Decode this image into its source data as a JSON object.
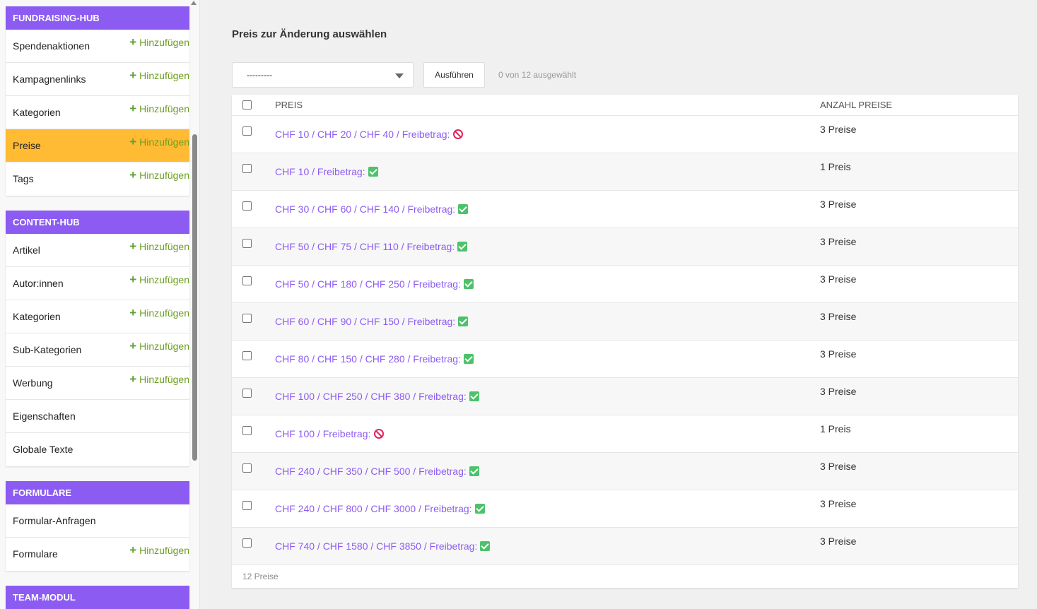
{
  "sidebar": {
    "modules": [
      {
        "title": "FUNDRAISING-HUB",
        "items": [
          {
            "label": "Spendenaktionen",
            "add": "Hinzufügen"
          },
          {
            "label": "Kampagnenlinks",
            "add": "Hinzufügen"
          },
          {
            "label": "Kategorien",
            "add": "Hinzufügen"
          },
          {
            "label": "Preise",
            "add": "Hinzufügen",
            "active": true
          },
          {
            "label": "Tags",
            "add": "Hinzufügen"
          }
        ]
      },
      {
        "title": "CONTENT-HUB",
        "items": [
          {
            "label": "Artikel",
            "add": "Hinzufügen"
          },
          {
            "label": "Autor:innen",
            "add": "Hinzufügen"
          },
          {
            "label": "Kategorien",
            "add": "Hinzufügen"
          },
          {
            "label": "Sub-Kategorien",
            "add": "Hinzufügen"
          },
          {
            "label": "Werbung",
            "add": "Hinzufügen"
          },
          {
            "label": "Eigenschaften",
            "add": ""
          },
          {
            "label": "Globale Texte",
            "add": ""
          }
        ]
      },
      {
        "title": "FORMULARE",
        "items": [
          {
            "label": "Formular-Anfragen",
            "add": ""
          },
          {
            "label": "Formulare",
            "add": "Hinzufügen"
          }
        ]
      },
      {
        "title": "TEAM-MODUL",
        "items": []
      }
    ]
  },
  "main": {
    "title": "Preis zur Änderung auswählen",
    "action_select_value": "---------",
    "run_label": "Ausführen",
    "selected_count": "0 von 12 ausgewählt",
    "columns": [
      "PREIS",
      "ANZAHL PREISE"
    ],
    "rows": [
      {
        "price": "CHF 10 / CHF 20 / CHF 40 / Freibetrag:",
        "freibetrag": false,
        "count": "3 Preise"
      },
      {
        "price": "CHF 10 / Freibetrag:",
        "freibetrag": true,
        "count": "1 Preis"
      },
      {
        "price": "CHF 30 / CHF 60 / CHF 140 / Freibetrag:",
        "freibetrag": true,
        "count": "3 Preise"
      },
      {
        "price": "CHF 50 / CHF 75 / CHF 110 / Freibetrag:",
        "freibetrag": true,
        "count": "3 Preise"
      },
      {
        "price": "CHF 50 / CHF 180 / CHF 250 / Freibetrag:",
        "freibetrag": true,
        "count": "3 Preise"
      },
      {
        "price": "CHF 60 / CHF 90 / CHF 150 / Freibetrag:",
        "freibetrag": true,
        "count": "3 Preise"
      },
      {
        "price": "CHF 80 / CHF 150 / CHF 280 / Freibetrag:",
        "freibetrag": true,
        "count": "3 Preise"
      },
      {
        "price": "CHF 100 / CHF 250 / CHF 380 / Freibetrag:",
        "freibetrag": true,
        "count": "3 Preise"
      },
      {
        "price": "CHF 100 / Freibetrag:",
        "freibetrag": false,
        "count": "1 Preis"
      },
      {
        "price": "CHF 240 / CHF 350 / CHF 500 / Freibetrag:",
        "freibetrag": true,
        "count": "3 Preise"
      },
      {
        "price": "CHF 240 / CHF 800 / CHF 3000 / Freibetrag:",
        "freibetrag": true,
        "count": "3 Preise"
      },
      {
        "price": "CHF 740 / CHF 1580 / CHF 3850 / Freibetrag:",
        "freibetrag": true,
        "count": "3 Preise"
      }
    ],
    "footer_count": "12 Preise"
  },
  "colors": {
    "module_header": "#8c5cf2",
    "active_item": "#ffbb33",
    "link": "#8c5cf2",
    "add": "#6b9e1f",
    "yes": "#4cc26a",
    "no": "#e0245e"
  },
  "icons": {
    "add": "plus-icon",
    "yes": "checkbox-checked-icon",
    "no": "prohibited-icon",
    "select": "caret-down-icon"
  }
}
